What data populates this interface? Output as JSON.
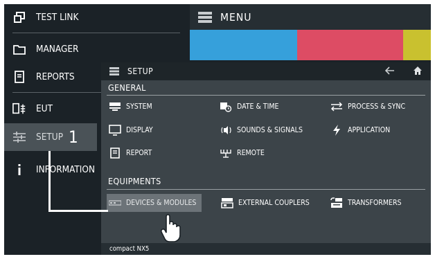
{
  "sidebar": {
    "items": [
      {
        "label": "TEST LINK",
        "icon": "window-link-icon"
      },
      {
        "label": "MANAGER",
        "icon": "folder-icon"
      },
      {
        "label": "REPORTS",
        "icon": "document-icon"
      },
      {
        "label": "EUT",
        "icon": "device-plug-icon"
      },
      {
        "label": "SETUP",
        "icon": "sliders-icon"
      },
      {
        "label": "INFORMATION",
        "icon": "info-icon"
      }
    ],
    "step_number": "1"
  },
  "header": {
    "menu_label": "MENU",
    "tile_colors": [
      "#36a0db",
      "#dd4c64",
      "#c9c12f"
    ]
  },
  "setup_panel": {
    "title": "SETUP",
    "back_icon": "arrow-left-icon",
    "home_icon": "home-icon",
    "general": {
      "title": "GENERAL",
      "options": [
        {
          "label": "SYSTEM",
          "icon": "system-icon"
        },
        {
          "label": "DATE & TIME",
          "icon": "calendar-clock-icon"
        },
        {
          "label": "PROCESS & SYNC",
          "icon": "sync-arrows-icon"
        },
        {
          "label": "DISPLAY",
          "icon": "monitor-icon"
        },
        {
          "label": "SOUNDS & SIGNALS",
          "icon": "speaker-icon"
        },
        {
          "label": "APPLICATION",
          "icon": "lightning-icon"
        },
        {
          "label": "REPORT",
          "icon": "report-icon"
        },
        {
          "label": "REMOTE",
          "icon": "remote-icon"
        }
      ]
    },
    "equipments": {
      "title": "EQUIPMENTS",
      "options": [
        {
          "label": "DEVICES & MODULES",
          "icon": "modules-icon",
          "selected": true
        },
        {
          "label": "EXTERNAL COUPLERS",
          "icon": "coupler-icon"
        },
        {
          "label": "TRANSFORMERS",
          "icon": "transformer-icon"
        }
      ]
    },
    "footer": "compact NX5"
  },
  "colors": {
    "background": "#1b2227",
    "panel": "#3c4449",
    "active_item": "#4a5257",
    "selected_option": "#6c7378"
  }
}
